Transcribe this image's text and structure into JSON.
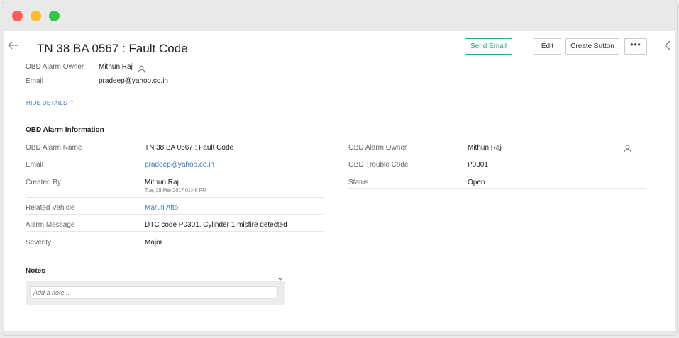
{
  "header": {
    "title": "TN 38 BA 0567 : Fault Code",
    "buttons": {
      "send_email": "Send Email",
      "edit": "Edit",
      "create_button": "Create Button",
      "more": "•••"
    }
  },
  "summary": {
    "owner_label": "OBD Alarm Owner",
    "owner_value": "Mithun Raj",
    "email_label": "Email",
    "email_value": "pradeep@yahoo.co.in",
    "hide_details": "HIDE DETAILS"
  },
  "info": {
    "title": "OBD Alarm Information",
    "left": [
      {
        "label": "OBD Alarm Name",
        "value": "TN 38 BA 0567 : Fault Code"
      },
      {
        "label": "Email",
        "value": "pradeep@yahoo.co.in"
      },
      {
        "label": "Created By",
        "value": "Mithun Raj",
        "sub": "Tue, 28 Mar 2017 01:46 PM"
      },
      {
        "label": "Related Vehicle",
        "value": "Maruti Alto"
      },
      {
        "label": "Alarm Message",
        "value": "DTC code P0301. Cylinder 1 misfire detected"
      },
      {
        "label": "Severity",
        "value": "Major"
      }
    ],
    "right": [
      {
        "label": "OBD Alarm Owner",
        "value": "Mithun Raj"
      },
      {
        "label": "OBD Trouble Code",
        "value": "P0301"
      },
      {
        "label": "Status",
        "value": "Open"
      }
    ]
  },
  "notes": {
    "title": "Notes",
    "placeholder": "Add a note..."
  },
  "colors": {
    "accent_green": "#27a784",
    "link_blue": "#3478c6"
  }
}
